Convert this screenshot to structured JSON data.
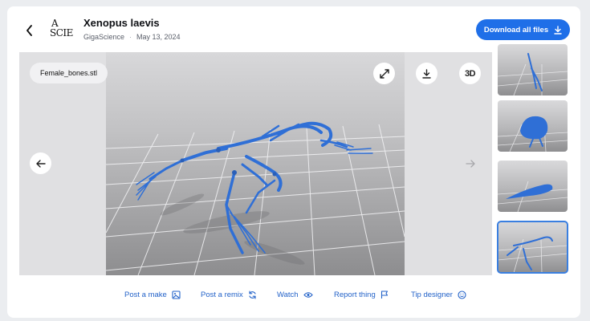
{
  "header": {
    "title": "Xenopus laevis",
    "publisher": "GigaScience",
    "date": "May 13, 2024",
    "logo_line1": "A",
    "logo_line2": "SCIE",
    "download_all_label": "Download all files"
  },
  "viewer": {
    "file_name": "Female_bones.stl",
    "threed_label": "3D"
  },
  "thumbnails": [
    {
      "name": "view-1"
    },
    {
      "name": "view-2"
    },
    {
      "name": "view-3"
    },
    {
      "name": "view-4",
      "selected": true
    }
  ],
  "actions": {
    "post_make": "Post a make",
    "post_remix": "Post a remix",
    "watch": "Watch",
    "report": "Report thing",
    "tip": "Tip designer"
  },
  "icons": {
    "back": "chevron-left-icon",
    "download": "download-icon",
    "expand": "expand-icon",
    "prev": "arrow-left-icon",
    "next": "arrow-right-icon",
    "make": "image-icon",
    "remix": "refresh-icon",
    "watch": "eye-icon",
    "report": "flag-icon",
    "tip": "smile-icon"
  },
  "colors": {
    "accent": "#1f6fe8",
    "model_blue": "#2f6fd6",
    "link": "#2463c9"
  }
}
